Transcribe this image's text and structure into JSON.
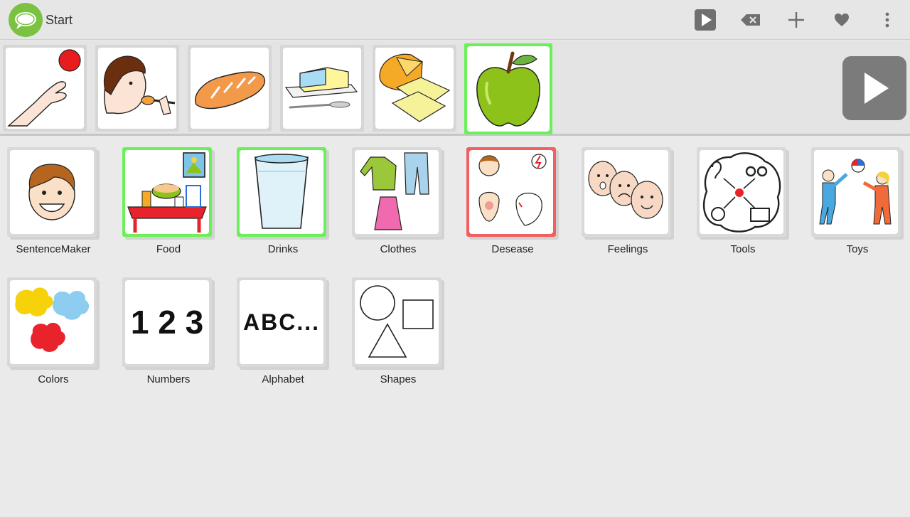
{
  "app": {
    "title": "Start"
  },
  "toolbar": {
    "play_icon": "play-icon",
    "backspace_icon": "backspace-icon",
    "add_icon": "plus-icon",
    "favorite_icon": "heart-icon",
    "overflow_icon": "more-vert-icon"
  },
  "sentence": {
    "items": [
      {
        "icon": "give-hand-ball-icon",
        "selected": false
      },
      {
        "icon": "eat-spoon-icon",
        "selected": false
      },
      {
        "icon": "bread-icon",
        "selected": false
      },
      {
        "icon": "butter-icon",
        "selected": false
      },
      {
        "icon": "cheese-icon",
        "selected": false
      },
      {
        "icon": "apple-icon",
        "selected": true
      }
    ],
    "speak_icon": "play-icon"
  },
  "categories": [
    {
      "label": "SentenceMaker",
      "icon": "boy-face-icon",
      "state": "none"
    },
    {
      "label": "Food",
      "icon": "food-table-icon",
      "state": "green"
    },
    {
      "label": "Drinks",
      "icon": "glass-water-icon",
      "state": "green"
    },
    {
      "label": "Clothes",
      "icon": "clothes-icon",
      "state": "none"
    },
    {
      "label": "Desease",
      "icon": "disease-icon",
      "state": "red"
    },
    {
      "label": "Feelings",
      "icon": "faces-icon",
      "state": "none"
    },
    {
      "label": "Tools",
      "icon": "tools-icon",
      "state": "none"
    },
    {
      "label": "Toys",
      "icon": "kids-ball-icon",
      "state": "none"
    },
    {
      "label": "Colors",
      "icon": "paint-splash-icon",
      "state": "none"
    },
    {
      "label": "Numbers",
      "icon": "numbers-icon",
      "state": "none",
      "text": "1 2 3"
    },
    {
      "label": "Alphabet",
      "icon": "alphabet-icon",
      "state": "none",
      "text": "ABC..."
    },
    {
      "label": "Shapes",
      "icon": "shapes-icon",
      "state": "none"
    }
  ],
  "colors": {
    "accent_green": "#6cf05a",
    "accent_red": "#f06060",
    "logo_green": "#7cc242"
  }
}
